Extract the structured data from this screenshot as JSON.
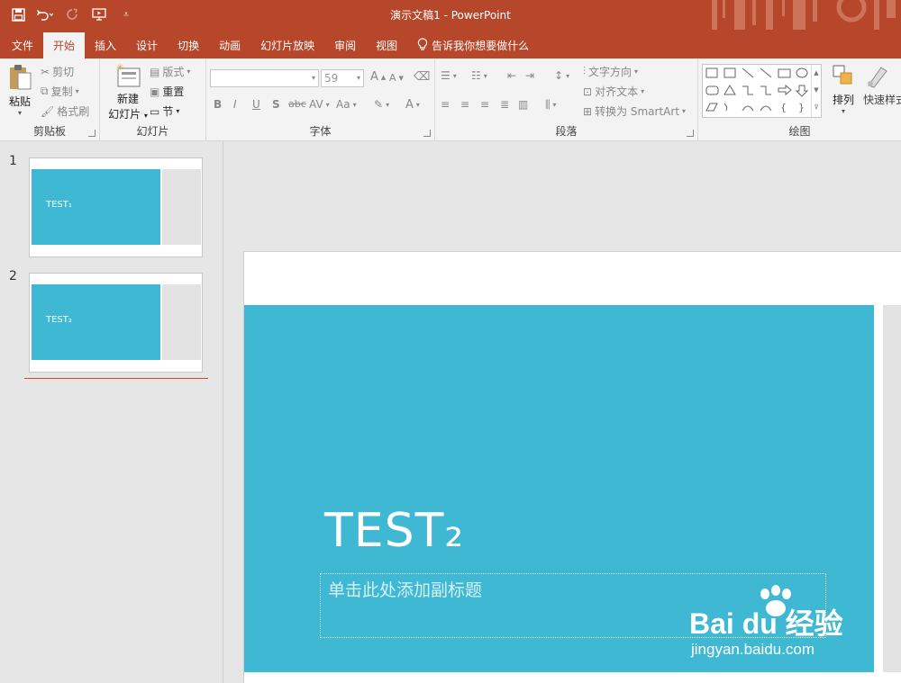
{
  "window": {
    "title": "演示文稿1  -  PowerPoint"
  },
  "tabs": [
    {
      "label": "文件"
    },
    {
      "label": "开始"
    },
    {
      "label": "插入"
    },
    {
      "label": "设计"
    },
    {
      "label": "切换"
    },
    {
      "label": "动画"
    },
    {
      "label": "幻灯片放映"
    },
    {
      "label": "审阅"
    },
    {
      "label": "视图"
    }
  ],
  "tell_me": "告诉我你想要做什么",
  "ribbon": {
    "clipboard": {
      "paste": "粘贴",
      "cut": "剪切",
      "copy": "复制",
      "format_painter": "格式刷",
      "label": "剪贴板"
    },
    "slides": {
      "new_line1": "新建",
      "new_line2": "幻灯片",
      "layout": "版式",
      "reset": "重置",
      "section": "节",
      "label": "幻灯片"
    },
    "font": {
      "font_name": "",
      "font_size": "59",
      "label": "字体",
      "bold": "B",
      "italic": "I",
      "underline": "U",
      "shadow": "S",
      "strike": "abc",
      "spacing": "AV",
      "case": "Aa",
      "color": "A",
      "grow": "A",
      "shrink": "A"
    },
    "paragraph": {
      "text_direction": "文字方向",
      "align_text": "对齐文本",
      "smartart": "转换为 SmartArt",
      "label": "段落"
    },
    "drawing": {
      "arrange": "排列",
      "quick_styles": "快速样式",
      "label": "绘图"
    }
  },
  "slides_pane": [
    {
      "number": "1",
      "text": "TEST₁"
    },
    {
      "number": "2",
      "text": "TEST₂"
    }
  ],
  "slide": {
    "title": "TEST₂",
    "subtitle_placeholder": "单击此处添加副标题"
  },
  "watermark": {
    "brand": "Bai  du 经验",
    "url": "jingyan.baidu.com"
  }
}
